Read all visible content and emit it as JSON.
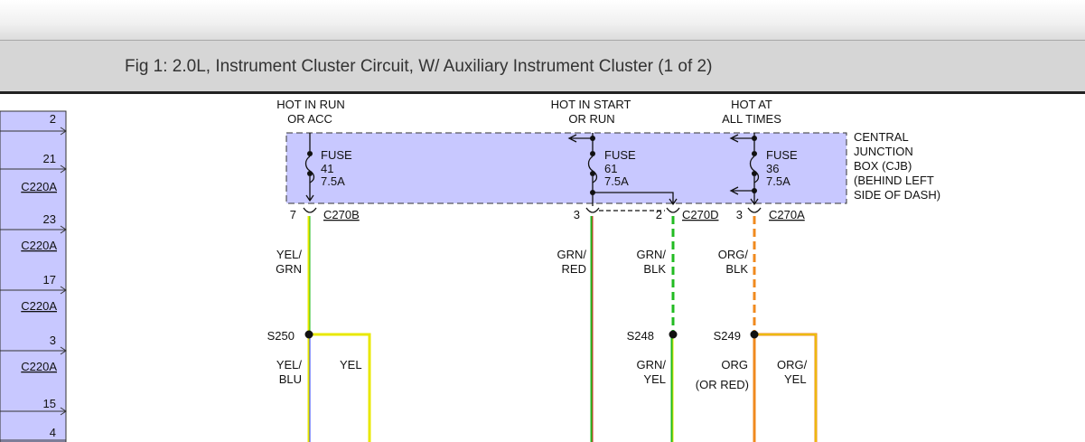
{
  "figure": {
    "title": "Fig 1: 2.0L, Instrument Cluster Circuit, W/ Auxiliary Instrument Cluster (1 of 2)"
  },
  "left_panel": {
    "pins": [
      "2",
      "21",
      "23",
      "17",
      "3",
      "15",
      "4"
    ],
    "connectors": [
      "C220A",
      "C220A",
      "C220A",
      "C220A"
    ]
  },
  "power_sources": {
    "run_acc": [
      "HOT IN RUN",
      "OR ACC"
    ],
    "start_run": [
      "HOT IN START",
      "OR RUN"
    ],
    "all_times": [
      "HOT AT",
      "ALL TIMES"
    ]
  },
  "cjb": {
    "label": [
      "CENTRAL",
      "JUNCTION",
      "BOX (CJB)",
      "(BEHIND LEFT",
      "SIDE OF DASH)"
    ],
    "fuses": [
      {
        "name": "FUSE",
        "number": "41",
        "rating": "7.5A"
      },
      {
        "name": "FUSE",
        "number": "61",
        "rating": "7.5A"
      },
      {
        "name": "FUSE",
        "number": "36",
        "rating": "7.5A"
      }
    ],
    "color": "#c8c8ff"
  },
  "connectors": [
    {
      "pin": "7",
      "name": "C270B"
    },
    {
      "pin": "3",
      "name": ""
    },
    {
      "pin": "2",
      "name": "C270D"
    },
    {
      "pin": "3",
      "name": "C270A"
    }
  ],
  "wires": {
    "yel_grn": [
      "YEL/",
      "GRN"
    ],
    "grn_red": [
      "GRN/",
      "RED"
    ],
    "grn_blk": [
      "GRN/",
      "BLK"
    ],
    "org_blk": [
      "ORG/",
      "BLK"
    ],
    "yel_blu": [
      "YEL/",
      "BLU"
    ],
    "yel": "YEL",
    "grn_yel": [
      "GRN/",
      "YEL"
    ],
    "org": [
      "ORG",
      "(OR RED)"
    ],
    "org_yel": [
      "ORG/",
      "YEL"
    ]
  },
  "splices": [
    "S250",
    "S248",
    "S249"
  ],
  "colors": {
    "yellow": "#e8e800",
    "green": "#22bb22",
    "orange": "#f08a1e",
    "red": "#e02020",
    "blue": "#2a3cff",
    "panel": "#c8c8ff"
  }
}
